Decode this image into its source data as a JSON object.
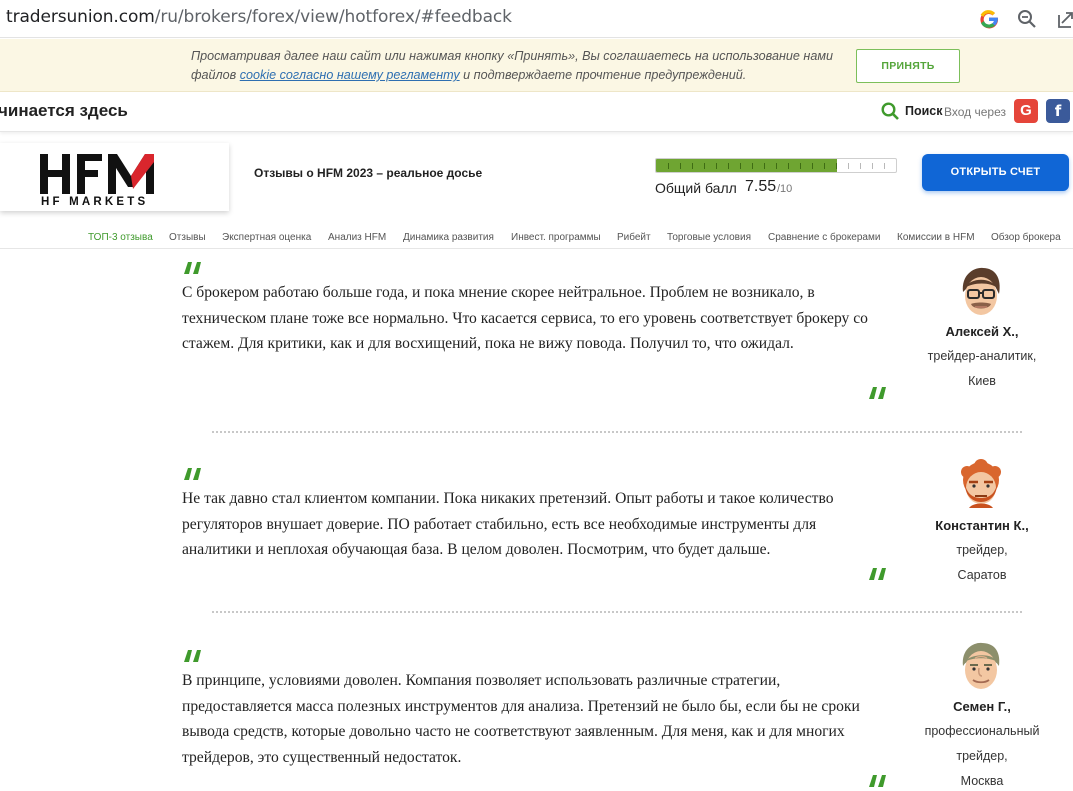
{
  "browser": {
    "url_host": "tradersunion.com",
    "url_path": "/ru/brokers/forex/view/hotforex/#feedback"
  },
  "cookie": {
    "text_before": "Просматривая далее наш сайт или нажимая кнопку «Принять», Вы соглашаетесь на использование нами файлов ",
    "link": "cookie согласно нашему регламенту",
    "text_after": " и подтверждаете прочтение предупреждений.",
    "accept_label": "ПРИНЯТЬ"
  },
  "topbar": {
    "slogan": "чинается здесь",
    "search_label": "Поиск",
    "login_label": "Вход через",
    "google_label": "G",
    "facebook_label": "f"
  },
  "broker": {
    "logo_text": "HF MARKETS",
    "title": "Отзывы о HFM 2023 – реальное досье",
    "score_label": "Общий балл",
    "score_value": "7.55",
    "score_max": "/10",
    "score_fraction": 0.755,
    "open_account_label": "ОТКРЫТЬ СЧЕТ",
    "accent_color": "#1066d6",
    "score_color": "#6fa532"
  },
  "nav": {
    "items": [
      "ТОП-3 отзыва",
      "Отзывы",
      "Экспертная оценка",
      "Анализ HFM",
      "Динамика развития",
      "Инвест. программы",
      "Рибейт",
      "Торговые условия",
      "Сравнение с брокерами",
      "Комиссии в HFM",
      "Обзор брокера"
    ],
    "active_color": "#3f9a2c"
  },
  "reviews": [
    {
      "text": "С брокером работаю больше года, и пока мнение скорее нейтральное. Проблем не возникало, в техническом плане тоже все нормально. Что касается сервиса, то его уровень соответствует брокеру со стажем. Для критики, как и для восхищений, пока не вижу повода. Получил то, что ожидал.",
      "name": "Алексей Х.,",
      "role": "трейдер-аналитик,",
      "city": "Киев",
      "avatar": "man-glasses-avatar"
    },
    {
      "text": "Не так давно стал клиентом компании. Пока никаких претензий. Опыт работы и такое количество регуляторов внушает доверие. ПО работает стабильно, есть все необходимые инструменты для аналитики и неплохая обучающая база. В целом доволен. Посмотрим, что будет дальше.",
      "name": "Константин К.,",
      "role": "трейдер,",
      "city": "Саратов",
      "avatar": "redhead-bearded-avatar"
    },
    {
      "text": "В принципе, условиями доволен. Компания позволяет использовать различные стратегии, предоставляется масса полезных инструментов для анализа. Претензий не было бы, если бы не сроки вывода средств, которые довольно часто не соответствуют заявленным. Для меня, как и для многих трейдеров, это существенный недостаток.",
      "name": "Семен Г.,",
      "role": "профессиональный трейдер,",
      "city": "Москва",
      "avatar": "older-man-avatar"
    }
  ]
}
